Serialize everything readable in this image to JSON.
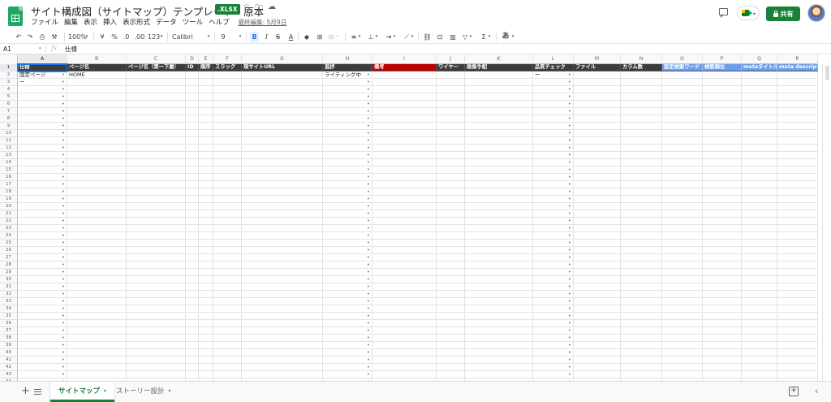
{
  "app": {
    "title": "サイト構成図（サイトマップ）テンプレート　原本",
    "file_badge": ".XLSX",
    "menus": [
      "ファイル",
      "編集",
      "表示",
      "挿入",
      "表示形式",
      "データ",
      "ツール",
      "ヘルプ"
    ],
    "last_edit": "最終編集: 5月9日",
    "share_label": "共有"
  },
  "icons": {
    "star": "☆",
    "folder": "🗀",
    "cloud": "☁",
    "undo": "↶",
    "redo": "↷",
    "print": "⎙",
    "paint_format": "⚒",
    "currency": "¥",
    "percent": "%",
    "dec_decrease": ".0",
    "dec_increase": ".00",
    "number_format": "123",
    "dropdown": "▾",
    "bold": "B",
    "italic": "I",
    "strike": "S",
    "text_color": "A",
    "fill_color": "◆",
    "borders": "⊞",
    "merge": "⊟",
    "halign": "≡",
    "valign": "⊥",
    "wrap": "⇥",
    "rotate": "⟋",
    "link": "⛓",
    "comment": "⊡",
    "chart": "▥",
    "filter": "▽",
    "functions": "Σ",
    "input_tools": "あ",
    "add_sheet": "+",
    "explore": "+",
    "collapse": "‹"
  },
  "toolbar": {
    "zoom": "100%",
    "font": "Calibri",
    "font_size": "9"
  },
  "formula_bar": {
    "name_box": "A1",
    "fx": "fx",
    "value": "仕様"
  },
  "columns": [
    "A",
    "B",
    "C",
    "D",
    "E",
    "F",
    "G",
    "H",
    "I",
    "J",
    "K",
    "L",
    "M",
    "N",
    "O",
    "P",
    "Q",
    "R"
  ],
  "header_row": [
    "仕様",
    "ページ名",
    "ページ名（第一下層）",
    "ID",
    "順序",
    "スラッグ",
    "現サイトURL",
    "進捗",
    "備考",
    "ワイヤー",
    "画像手配",
    "品質チェック",
    "ファイル",
    "カラム数",
    "設定検索ワード",
    "検索順位",
    "metaタイトル",
    "meta description"
  ],
  "data_rows": [
    {
      "A": "固定ページ",
      "B": "HOME",
      "H": "ライティング中",
      "L": "ー"
    },
    {
      "A": "ー"
    }
  ],
  "row_numbers": [
    "1",
    "2",
    "3",
    "4",
    "5",
    "6",
    "7",
    "8",
    "9",
    "10",
    "11",
    "12",
    "13",
    "14",
    "15",
    "16",
    "17",
    "18",
    "19",
    "20",
    "21",
    "22",
    "23",
    "24",
    "25",
    "26",
    "27",
    "28",
    "29",
    "30",
    "31",
    "32",
    "33",
    "34",
    "35",
    "36",
    "37",
    "38",
    "39",
    "40",
    "41",
    "42",
    "43",
    "44"
  ],
  "sheet_tabs": [
    {
      "label": "サイトマップ",
      "active": true
    },
    {
      "label": "ストーリー設計",
      "active": false
    }
  ],
  "colors": {
    "header_dark": "#3c3c3c",
    "header_red": "#c00000",
    "header_blue": "#6d9eeb",
    "accent_green": "#188038",
    "selection_blue": "#1a73e8"
  }
}
